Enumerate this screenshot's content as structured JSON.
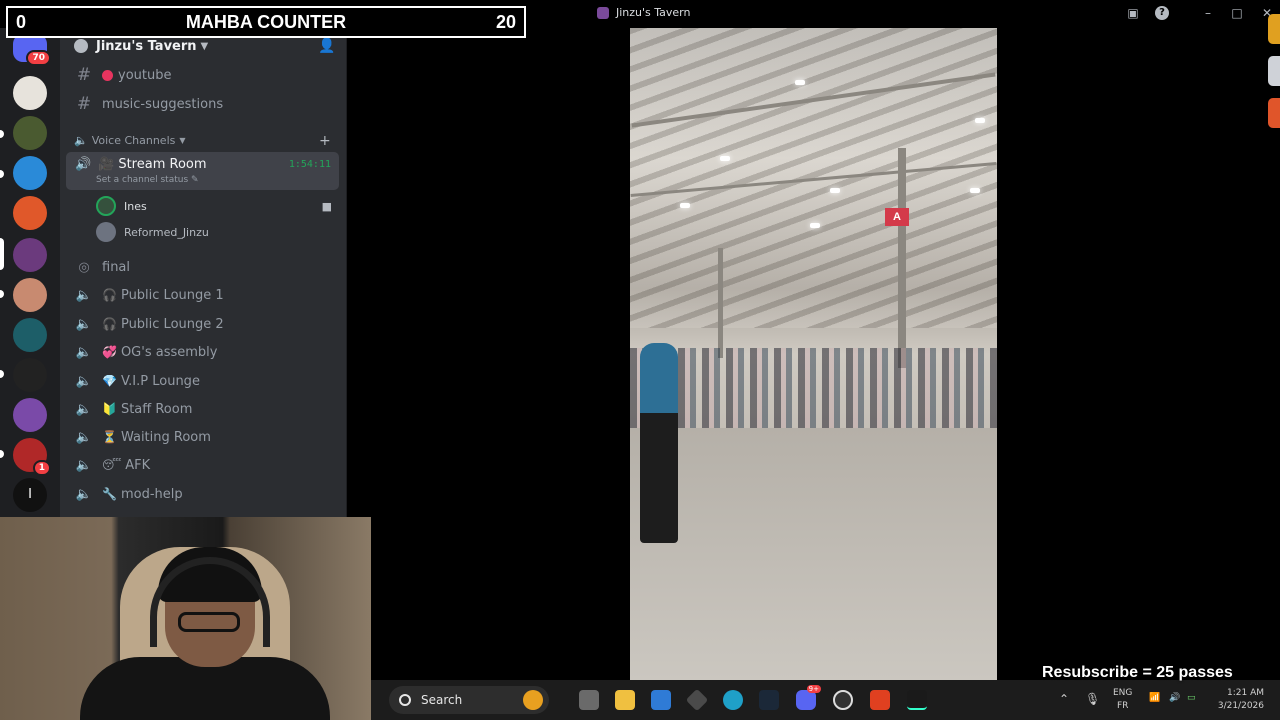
{
  "counter": {
    "left_value": "0",
    "title": "MAHBA COUNTER",
    "right_value": "20"
  },
  "window": {
    "title": "Jinzu's Tavern"
  },
  "rail": {
    "badge_top": "70",
    "badge_bottom": "1",
    "letter_server": "I"
  },
  "server": {
    "name": "Jinzu's Tavern"
  },
  "channels": {
    "text": [
      {
        "name": "youtube"
      },
      {
        "name": "music-suggestions"
      }
    ],
    "voice_category": "Voice Channels",
    "stream_room": {
      "name": "Stream Room",
      "timer": "1:54:11",
      "status": "Set a channel status",
      "users": [
        {
          "name": "Ines"
        },
        {
          "name": "Reformed_Jinzu"
        }
      ]
    },
    "voice": [
      {
        "name": "final",
        "emoji": ""
      },
      {
        "name": "Public Lounge 1",
        "emoji": "🎧"
      },
      {
        "name": "Public Lounge 2",
        "emoji": "🎧"
      },
      {
        "name": "OG's assembly",
        "emoji": "💞"
      },
      {
        "name": "V.I.P Lounge",
        "emoji": "💎"
      },
      {
        "name": "Staff Room",
        "emoji": "🔰"
      },
      {
        "name": "Waiting Room",
        "emoji": "⏳"
      },
      {
        "name": "AFK",
        "emoji": "😴"
      },
      {
        "name": "mod-help",
        "emoji": "🔧"
      }
    ]
  },
  "video": {
    "sign_text": "A"
  },
  "overlay": {
    "resub_text": "Resubscribe = 25 passes"
  },
  "taskbar": {
    "search_placeholder": "Search",
    "discord_badge": "9+",
    "lang_top": "ENG",
    "lang_bottom": "FR",
    "time": "1:21 AM",
    "date": "3/21/2026"
  },
  "colors": {
    "accent_green": "#23a55a",
    "badge_red": "#f23f43",
    "sidebar_bg": "#2b2d31",
    "rail_bg": "#1e1f22"
  }
}
